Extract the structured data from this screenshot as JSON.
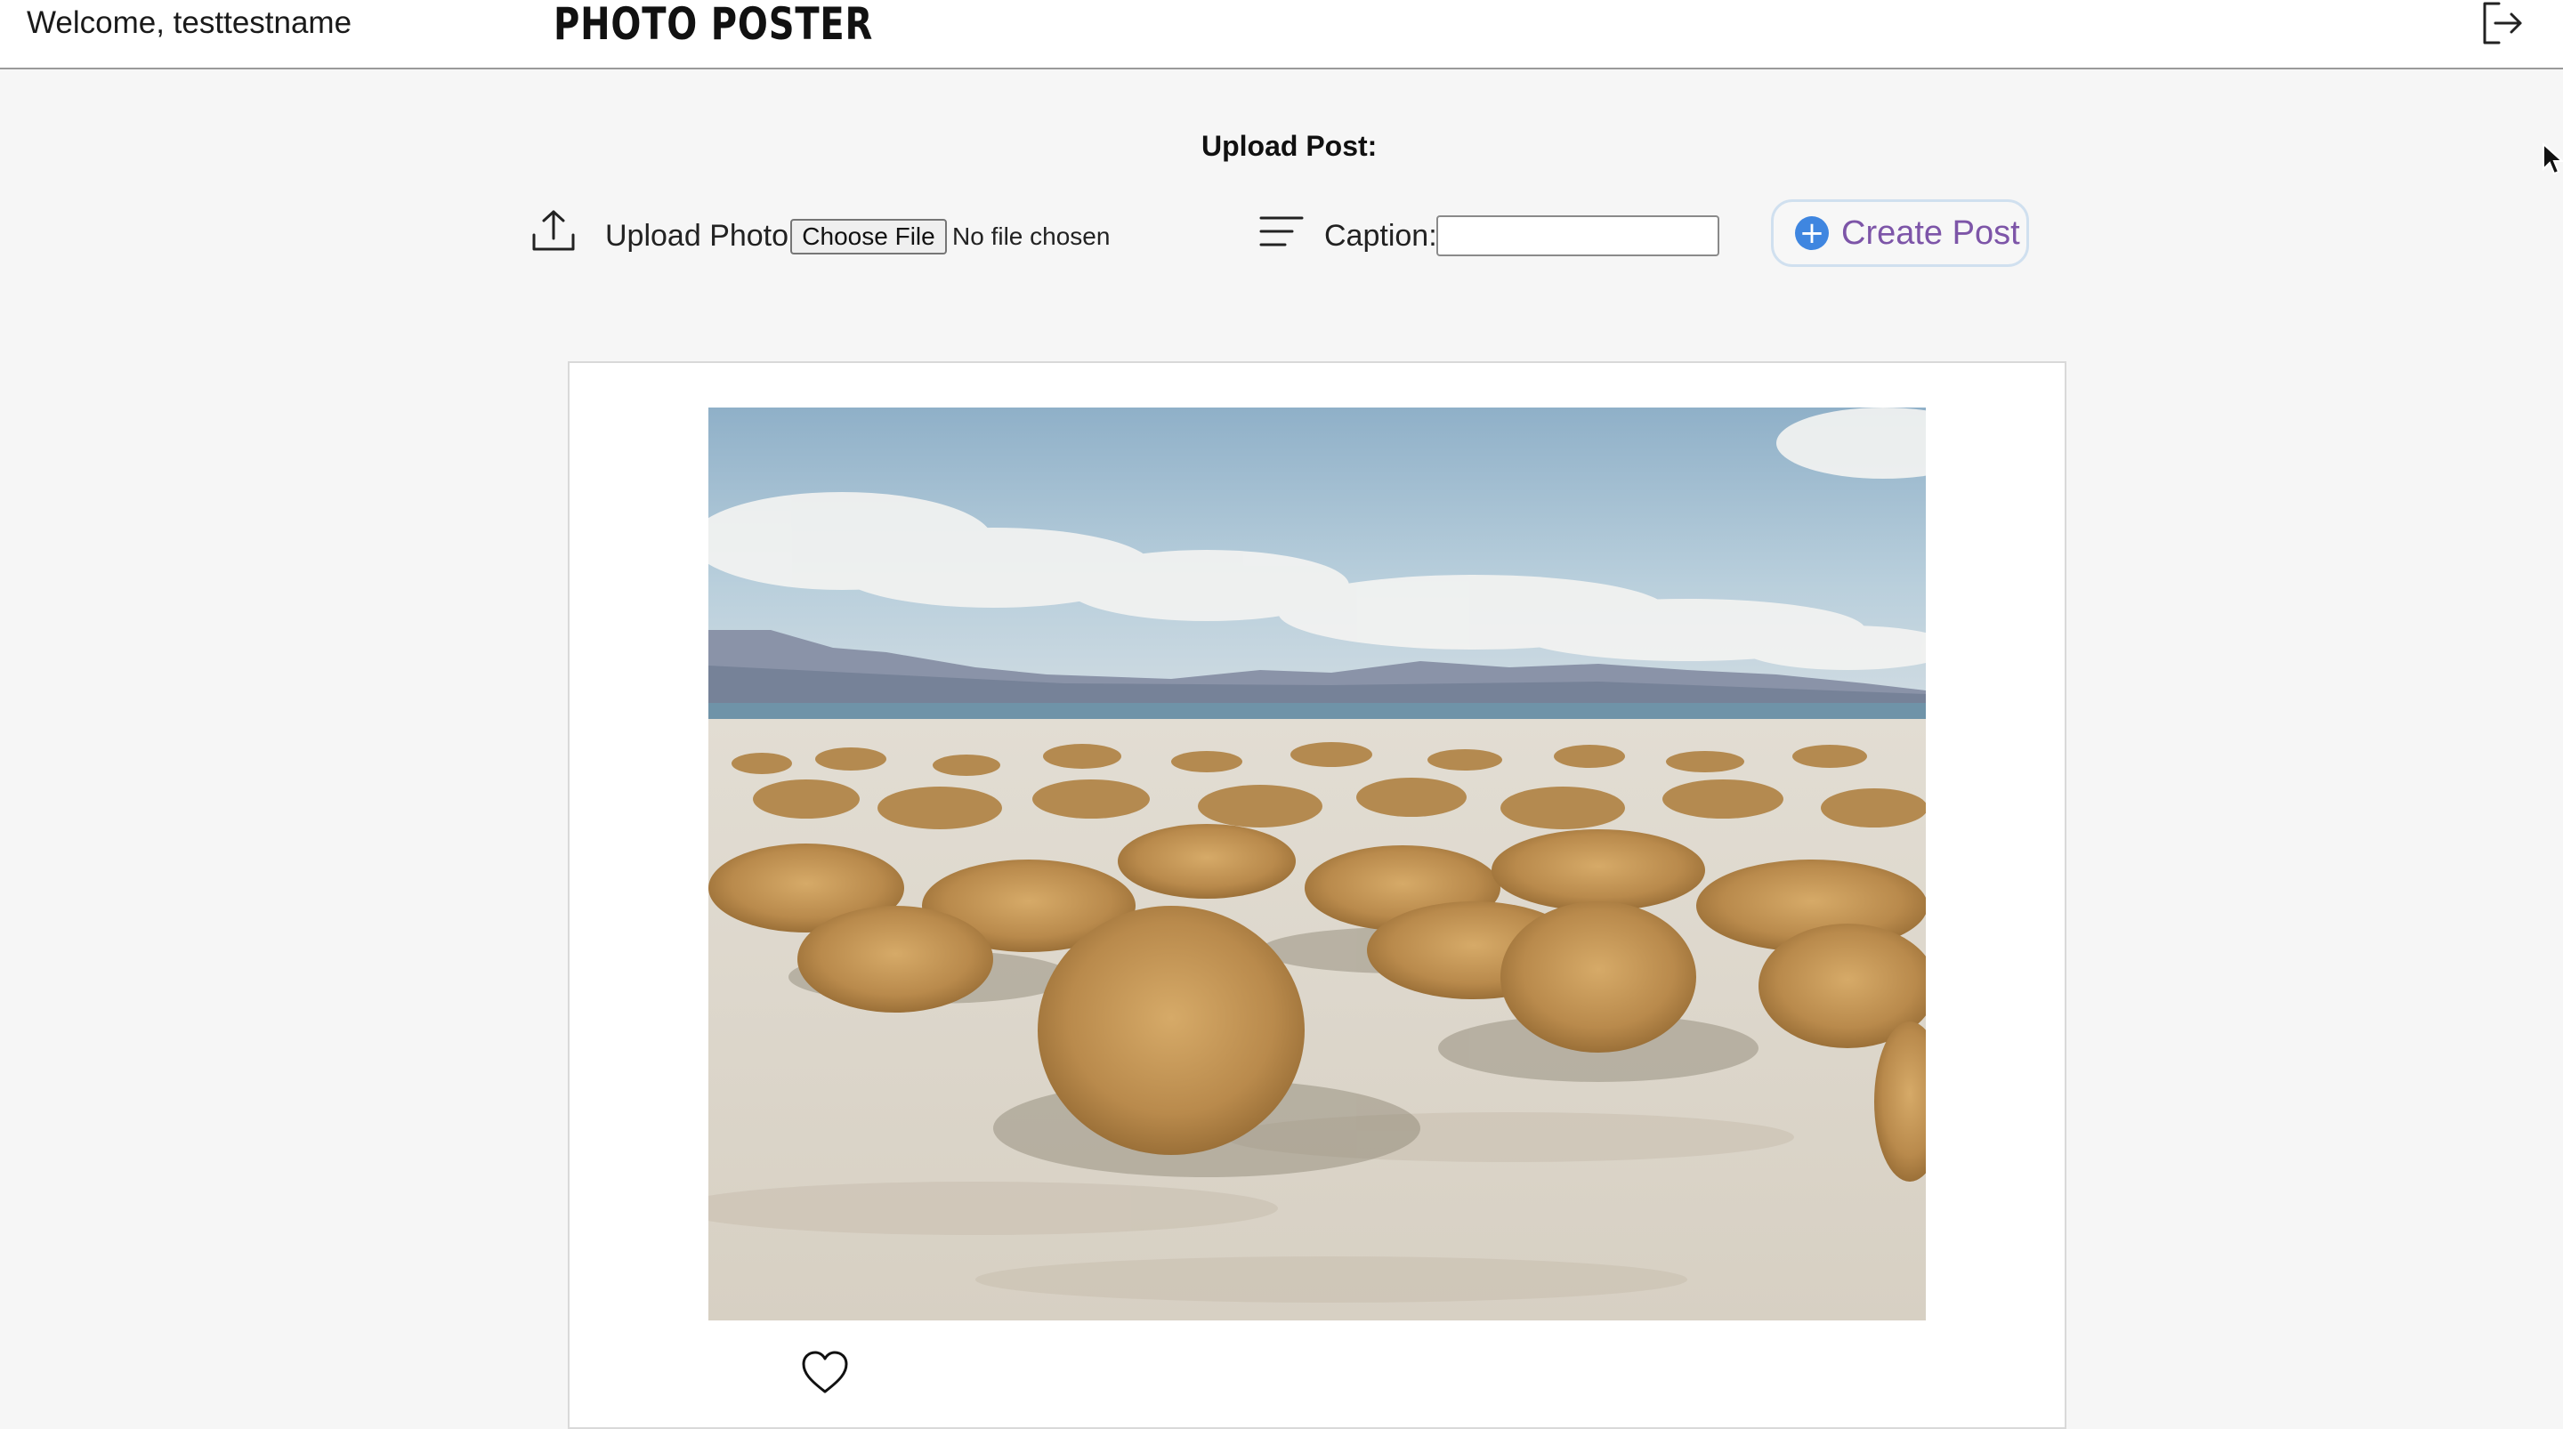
{
  "header": {
    "welcome_text": "Welcome, testtestname",
    "brand": "PHOTO POSTER",
    "logout_icon": "logout-icon"
  },
  "upload": {
    "title": "Upload Post:",
    "photo_label": "Upload Photo:",
    "file_button": "Choose File",
    "file_status": "No file chosen",
    "caption_label": "Caption:",
    "caption_value": "",
    "create_button": "Create Post",
    "upload_icon": "upload-icon",
    "caption_icon": "text-align-left-icon",
    "plus_icon": "plus-circle-icon"
  },
  "post": {
    "photo_subject": "desert-dunes-with-dry-shrubs-photo",
    "like_icon": "heart-icon"
  },
  "colors": {
    "create_text": "#7d55a8",
    "plus_fill": "#3f86e0",
    "page_bg": "#f6f6f6"
  }
}
